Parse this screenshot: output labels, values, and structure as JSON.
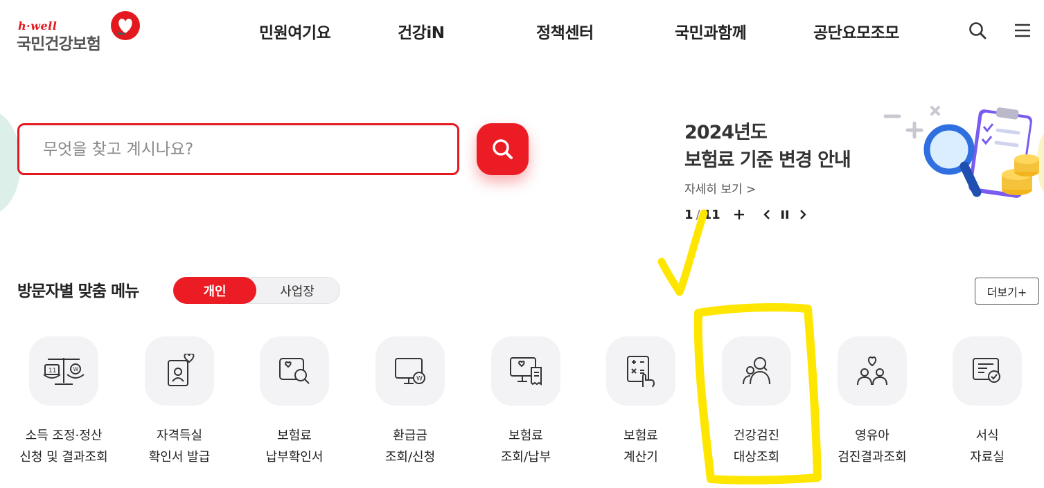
{
  "header": {
    "logo_tagline": "h·well",
    "logo_brand": "국민건강보험",
    "nav": [
      {
        "label": "민원여기요"
      },
      {
        "label": "건강iN"
      },
      {
        "label": "정책센터"
      },
      {
        "label": "국민과함께"
      },
      {
        "label": "공단요모조모"
      }
    ],
    "icons": [
      "search-icon",
      "menu-icon"
    ]
  },
  "search": {
    "placeholder": "무엇을 찾고 계시나요?",
    "value": ""
  },
  "notice": {
    "title_line1": "2024년도",
    "title_line2": "보험료 기준 변경 안내",
    "link_label": "자세히 보기 >",
    "page_current": "1",
    "page_separator": "/",
    "page_total": "11",
    "controls": [
      "plus-icon",
      "prev-icon",
      "pause-icon",
      "next-icon"
    ]
  },
  "visitor_menu": {
    "title": "방문자별 맞춤 메뉴",
    "toggle_active": "개인",
    "toggle_inactive": "사업장",
    "more_label": "더보기+",
    "items": [
      {
        "line1": "소득 조정·정산",
        "line2": "신청 및 결과조회",
        "icon": "scale-icon"
      },
      {
        "line1": "자격득실",
        "line2": "확인서 발급",
        "icon": "id-card-icon"
      },
      {
        "line1": "보험료",
        "line2": "납부확인서",
        "icon": "document-search-icon"
      },
      {
        "line1": "환급금",
        "line2": "조회/신청",
        "icon": "monitor-won-icon"
      },
      {
        "line1": "보험료",
        "line2": "조회/납부",
        "icon": "monitor-receipt-icon"
      },
      {
        "line1": "보험료",
        "line2": "계산기",
        "icon": "calculator-icon"
      },
      {
        "line1": "건강검진",
        "line2": "대상조회",
        "icon": "people-search-icon"
      },
      {
        "line1": "영유아",
        "line2": "검진결과조회",
        "icon": "family-icon"
      },
      {
        "line1": "서식",
        "line2": "자료실",
        "icon": "form-check-icon"
      }
    ]
  },
  "colors": {
    "brand_red": "#ec1c24",
    "highlight_yellow": "#ffe600",
    "tile_bg": "#f3f3f5"
  }
}
